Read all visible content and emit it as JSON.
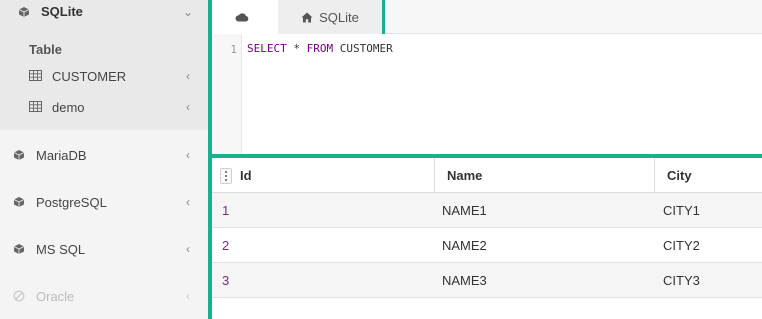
{
  "sidebar": {
    "databases": [
      {
        "label": "SQLite",
        "icon": "cube-icon",
        "state": "active"
      },
      {
        "label": "MariaDB",
        "icon": "cube-icon",
        "state": "normal"
      },
      {
        "label": "PostgreSQL",
        "icon": "cube-icon",
        "state": "normal"
      },
      {
        "label": "MS SQL",
        "icon": "cube-icon",
        "state": "normal"
      },
      {
        "label": "Oracle",
        "icon": "ban-icon",
        "state": "disabled"
      }
    ],
    "section_label": "Table",
    "tables": [
      {
        "label": "CUSTOMER",
        "icon": "table-icon"
      },
      {
        "label": "demo",
        "icon": "table-icon"
      }
    ]
  },
  "tabs": [
    {
      "label": "",
      "icon": "cloud-icon",
      "active": true
    },
    {
      "label": "SQLite",
      "icon": "home-icon",
      "active": false
    }
  ],
  "editor": {
    "line_number": "1",
    "query": {
      "select": "SELECT",
      "star": " * ",
      "from": "FROM",
      "table": " CUSTOMER"
    }
  },
  "grid": {
    "columns": [
      "Id",
      "Name",
      "City"
    ],
    "rows": [
      [
        "1",
        "NAME1",
        "CITY1"
      ],
      [
        "2",
        "NAME2",
        "CITY2"
      ],
      [
        "3",
        "NAME3",
        "CITY3"
      ]
    ]
  },
  "colors": {
    "accent": "#1aaf8f",
    "keyword": "#770088",
    "id_value": "#7a2a7a"
  }
}
